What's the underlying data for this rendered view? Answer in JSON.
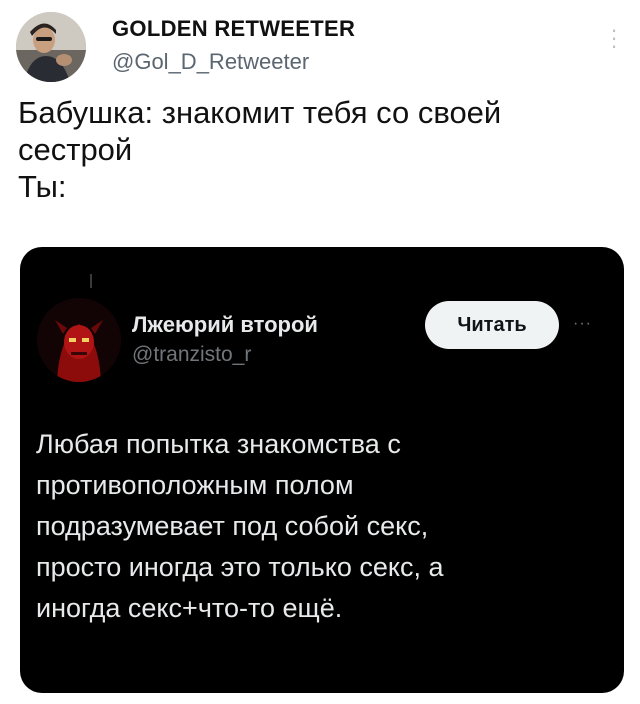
{
  "tweet": {
    "author": {
      "display_name": "GOLDEN RETWEETER",
      "handle": "@Gol_D_Retweeter"
    },
    "more_icon": "vertical-ellipsis-icon",
    "text_lines": [
      "Бабушка: знакомит тебя со своей",
      "сестрой",
      "Ты:"
    ]
  },
  "embedded_tweet": {
    "author": {
      "display_name": "Лжеюрий второй",
      "handle": "@tranzisto_r"
    },
    "follow_button_label": "Читать",
    "more_icon": "horizontal-ellipsis-icon",
    "text_lines": [
      "Любая попытка знакомства с",
      "противоположным полом",
      "подразумевает под собой секс,",
      "просто иногда это только секс, а",
      "иногда секс+что-то ещё."
    ],
    "background_color": "#000000"
  }
}
